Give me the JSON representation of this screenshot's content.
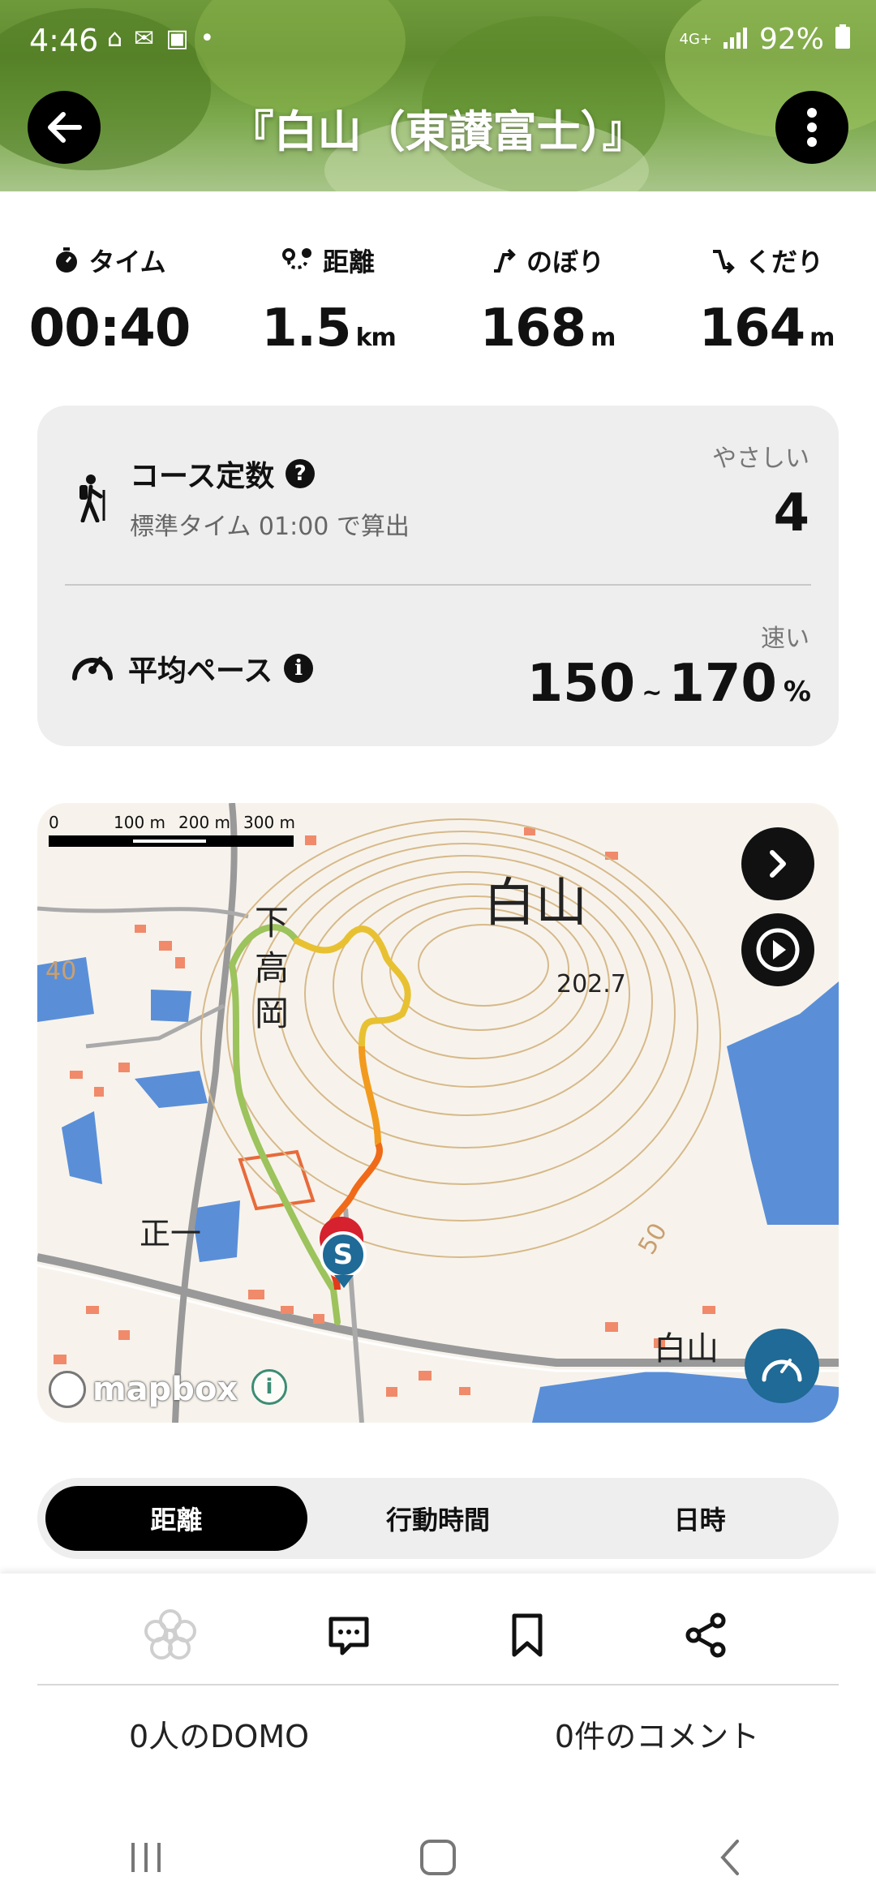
{
  "status_bar": {
    "time": "4:46",
    "network": "4G+",
    "battery": "92%"
  },
  "header": {
    "title": "『白山（東讃富士）』"
  },
  "stats": [
    {
      "icon": "stopwatch-icon",
      "label": "タイム",
      "value": "00:40",
      "unit": ""
    },
    {
      "icon": "route-icon",
      "label": "距離",
      "value": "1.5",
      "unit": "km"
    },
    {
      "icon": "ascent-icon",
      "label": "のぼり",
      "value": "168",
      "unit": "m"
    },
    {
      "icon": "descent-icon",
      "label": "くだり",
      "value": "164",
      "unit": "m"
    }
  ],
  "course": {
    "title": "コース定数",
    "help": "?",
    "subtitle": "標準タイム 01:00 で算出",
    "difficulty": "やさしい",
    "value": "4"
  },
  "pace": {
    "title": "平均ペース",
    "info": "i",
    "speed_label": "速い",
    "min": "150",
    "sep": "~",
    "max": "170",
    "unit": "%"
  },
  "map": {
    "scale_labels": [
      "0",
      "100 m",
      "200 m",
      "300 m"
    ],
    "place_labels": {
      "peak": "白山",
      "elevation": "202.7",
      "village": "下高岡",
      "lower_right": "白山",
      "contour50": "50",
      "contour40": "40",
      "village2": "正一"
    },
    "start_marker": "S",
    "attribution": "mapbox",
    "route_colors": [
      "#9cc35c",
      "#e8c132",
      "#f29a1e",
      "#f06a1a",
      "#e23a1a"
    ]
  },
  "tabs": {
    "items": [
      "距離",
      "行動時間",
      "日時"
    ],
    "active": 0
  },
  "actions": {
    "domo_count": "0人のDOMO",
    "comment_count": "0件のコメント"
  },
  "colors": {
    "accent_blue": "#1f6a96",
    "marker_red": "#d6212e"
  }
}
